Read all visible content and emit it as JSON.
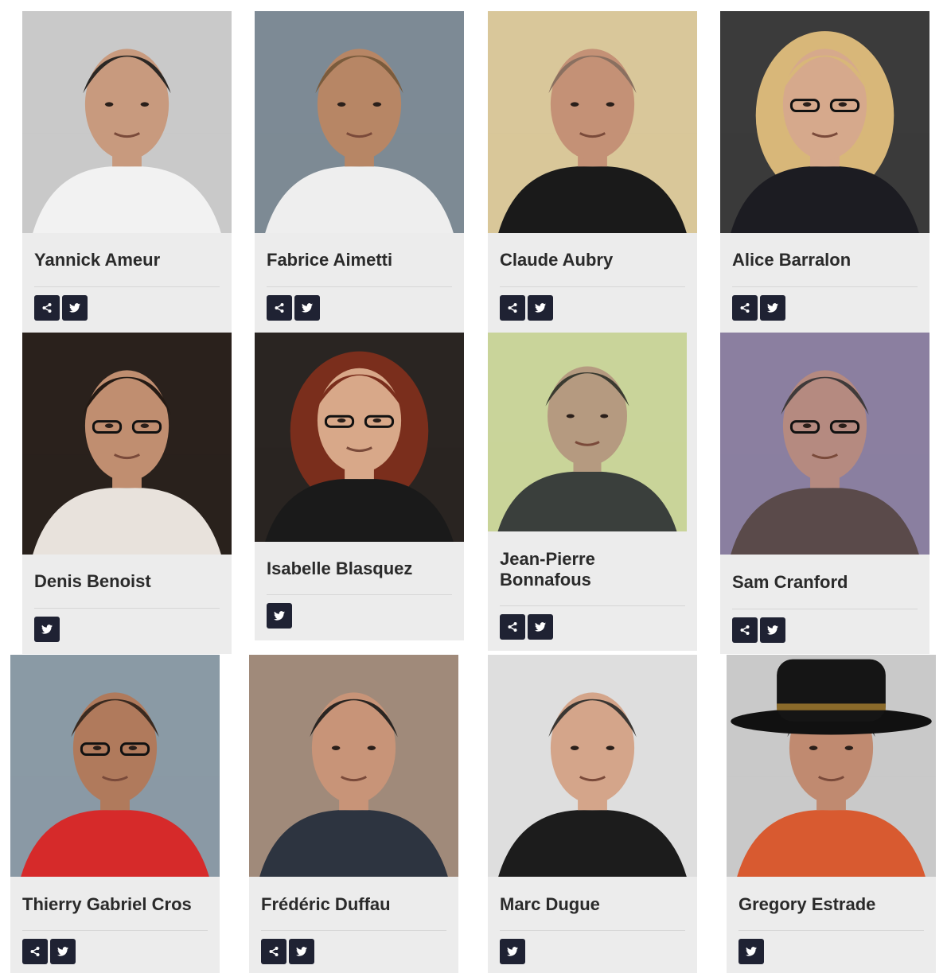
{
  "people": [
    {
      "name": "Yannick Ameur",
      "buttons": [
        "share-icon",
        "twitter-icon"
      ],
      "bg": "#c9c9c9",
      "skin": "#c89a7e",
      "hair": "#2b2724",
      "shirt": "#f2f2f2"
    },
    {
      "name": "Fabrice Aimetti",
      "buttons": [
        "share-icon",
        "twitter-icon"
      ],
      "bg": "#7d8a95",
      "skin": "#b78665",
      "hair": "#7a5b3c",
      "shirt": "#eeeeee"
    },
    {
      "name": "Claude Aubry",
      "buttons": [
        "share-icon",
        "twitter-icon"
      ],
      "bg": "#d9c79a",
      "skin": "#c49176",
      "hair": "#8a7060",
      "shirt": "#1a1a1a"
    },
    {
      "name": "Alice Barralon",
      "buttons": [
        "share-icon",
        "twitter-icon"
      ],
      "bg": "#3b3b3b",
      "skin": "#d6a98c",
      "hair": "#d8b779",
      "shirt": "#1c1c22"
    },
    {
      "name": "Denis Benoist",
      "buttons": [
        "twitter-icon"
      ],
      "bg": "#2a211c",
      "skin": "#c08e70",
      "hair": "#241a14",
      "shirt": "#e8e2dc"
    },
    {
      "name": "Isabelle Blasquez",
      "buttons": [
        "twitter-icon"
      ],
      "bg": "#2a2522",
      "skin": "#d8a889",
      "hair": "#7a2e1c",
      "shirt": "#1a1a1a"
    },
    {
      "name": "Jean-Pierre Bonnafous",
      "buttons": [
        "share-icon",
        "twitter-icon"
      ],
      "bg": "#c9d49a",
      "skin": "#b59a80",
      "hair": "#3a3a30",
      "shirt": "#3a3f3c"
    },
    {
      "name": "Sam Cranford",
      "buttons": [
        "share-icon",
        "twitter-icon"
      ],
      "bg": "#8b7fa0",
      "skin": "#b58a80",
      "hair": "#3f3a3a",
      "shirt": "#5a4a4a"
    },
    {
      "name": "Thierry Gabriel Cros",
      "buttons": [
        "share-icon",
        "twitter-icon"
      ],
      "bg": "#8a9aa5",
      "skin": "#b07a5c",
      "hair": "#3a2a20",
      "shirt": "#d62a2a"
    },
    {
      "name": "Frédéric Duffau",
      "buttons": [
        "share-icon",
        "twitter-icon"
      ],
      "bg": "#a08a7a",
      "skin": "#c89478",
      "hair": "#2a2522",
      "shirt": "#2d3440"
    },
    {
      "name": "Marc Dugue",
      "buttons": [
        "twitter-icon"
      ],
      "bg": "#dedede",
      "skin": "#d4a58a",
      "hair": "#3a3632",
      "shirt": "#1c1c1c"
    },
    {
      "name": "Gregory Estrade",
      "buttons": [
        "twitter-icon"
      ],
      "bg": "#c9c9c9",
      "skin": "#c08a70",
      "hair": "#111111",
      "shirt": "#d85a30"
    }
  ]
}
